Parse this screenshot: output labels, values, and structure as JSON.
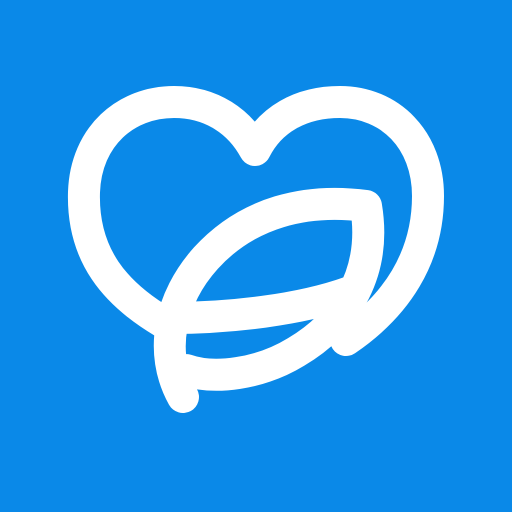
{
  "icon": {
    "name": "heart-leaf-logo-icon",
    "background_color": "#0A89E8",
    "foreground_color": "#FFFFFF"
  }
}
